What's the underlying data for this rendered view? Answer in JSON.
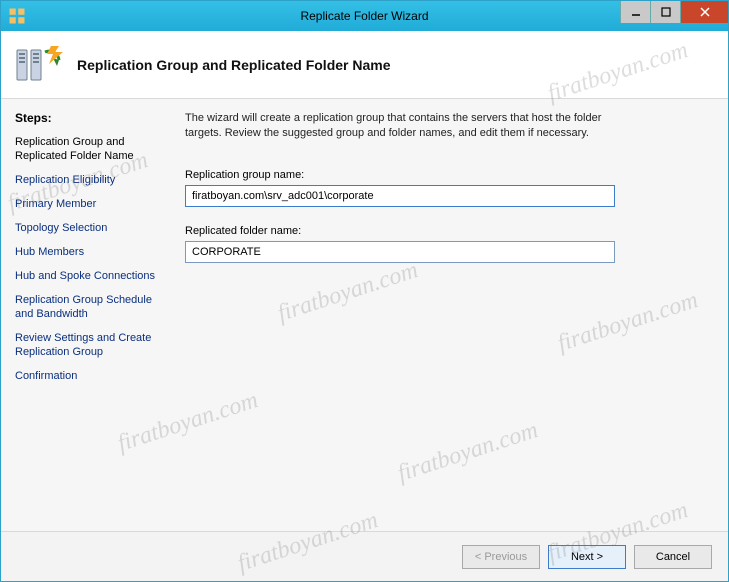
{
  "window": {
    "title": "Replicate Folder Wizard"
  },
  "header": {
    "title": "Replication Group and Replicated Folder Name"
  },
  "sidebar": {
    "heading": "Steps:",
    "items": [
      {
        "label": "Replication Group and Replicated Folder Name"
      },
      {
        "label": "Replication Eligibility"
      },
      {
        "label": "Primary Member"
      },
      {
        "label": "Topology Selection"
      },
      {
        "label": "Hub Members"
      },
      {
        "label": "Hub and Spoke Connections"
      },
      {
        "label": "Replication Group Schedule and Bandwidth"
      },
      {
        "label": "Review Settings and Create Replication Group"
      },
      {
        "label": "Confirmation"
      }
    ]
  },
  "main": {
    "description": "The wizard will create a replication group that contains the servers that host the folder targets. Review the suggested group and folder names, and edit them if necessary.",
    "group_name_label": "Replication group name:",
    "group_name_value": "firatboyan.com\\srv_adc001\\corporate",
    "folder_name_label": "Replicated folder name:",
    "folder_name_value": "CORPORATE"
  },
  "footer": {
    "previous": "< Previous",
    "next": "Next >",
    "cancel": "Cancel"
  },
  "watermark_text": "firatboyan.com"
}
